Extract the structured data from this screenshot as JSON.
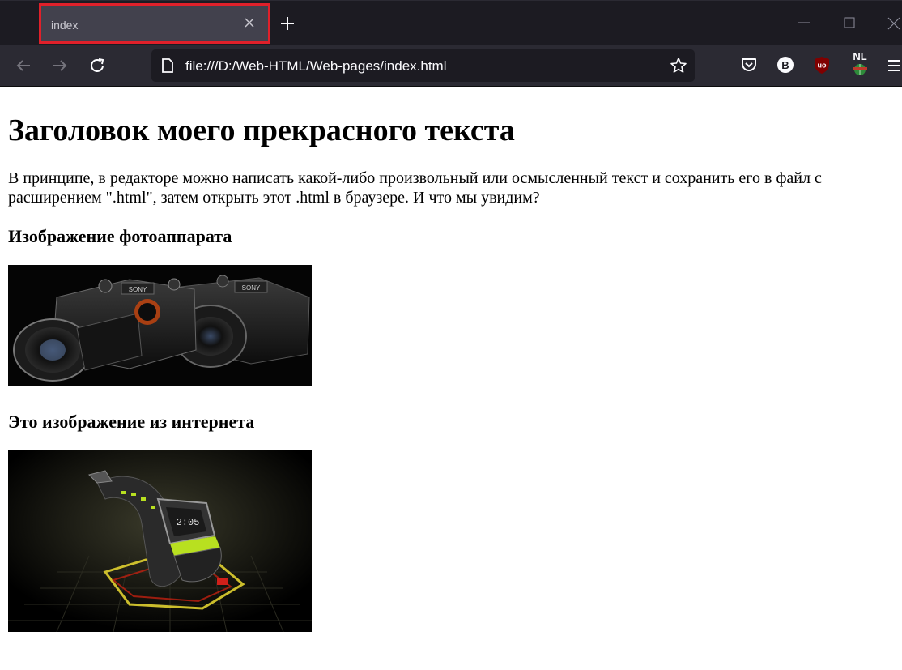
{
  "browser": {
    "tab": {
      "title": "index"
    },
    "url": "file:///D:/Web-HTML/Web-pages/index.html",
    "extensions": {
      "b_badge": "B",
      "nl_badge": "NL"
    },
    "colors": {
      "chrome_dark": "#1c1b22",
      "toolbar": "#2b2a33",
      "tab_active": "#42414d",
      "tab_highlight": "#e0202a"
    }
  },
  "page": {
    "heading": "Заголовок моего прекрасного текста",
    "paragraph": "В принципе, в редакторе можно написать какой-либо произвольный или осмысленный текст и сохранить его в файл с расширением \".html\", затем открыть этот .html в браузере. И что мы увидим?",
    "camera_heading": "Изображение фотоаппарата",
    "camera_image": {
      "brand": "SONY"
    },
    "internet_heading": "Это изображение из интернета"
  }
}
